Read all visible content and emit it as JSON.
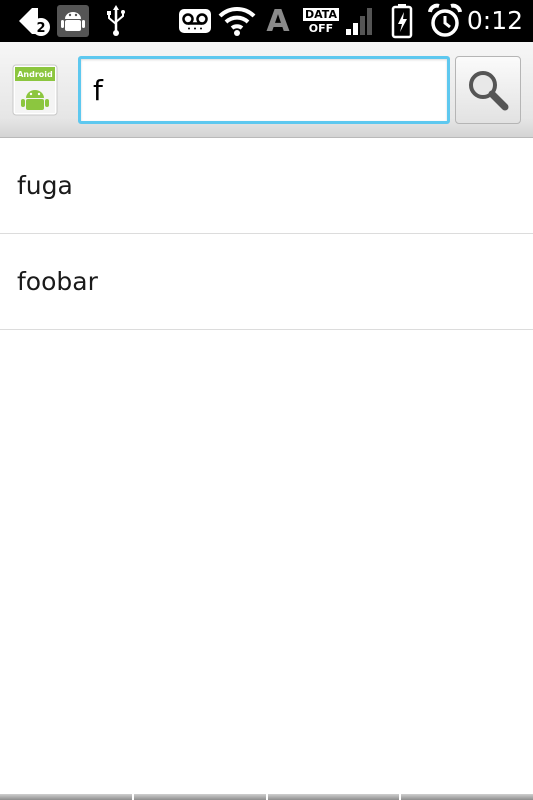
{
  "status_bar": {
    "time": "0:12",
    "notification_count": "2",
    "data_label_top": "DATA",
    "data_label_bottom": "OFF",
    "font_indicator": "A",
    "icons": [
      "chat-notification-icon",
      "android-debug-icon",
      "usb-icon",
      "voicemail-icon",
      "wifi-icon",
      "font-indicator-icon",
      "data-off-icon",
      "signal-icon",
      "battery-charging-icon",
      "alarm-icon"
    ]
  },
  "search": {
    "app_icon_label": "Android",
    "query": "f",
    "button_icon": "search-icon"
  },
  "suggestions": [
    {
      "label": "fuga"
    },
    {
      "label": "foobar"
    }
  ],
  "colors": {
    "status_bar_bg": "#000000",
    "search_focus_border": "#5ec8ef",
    "android_green": "#8cc63f",
    "divider": "#dcdcdc"
  }
}
